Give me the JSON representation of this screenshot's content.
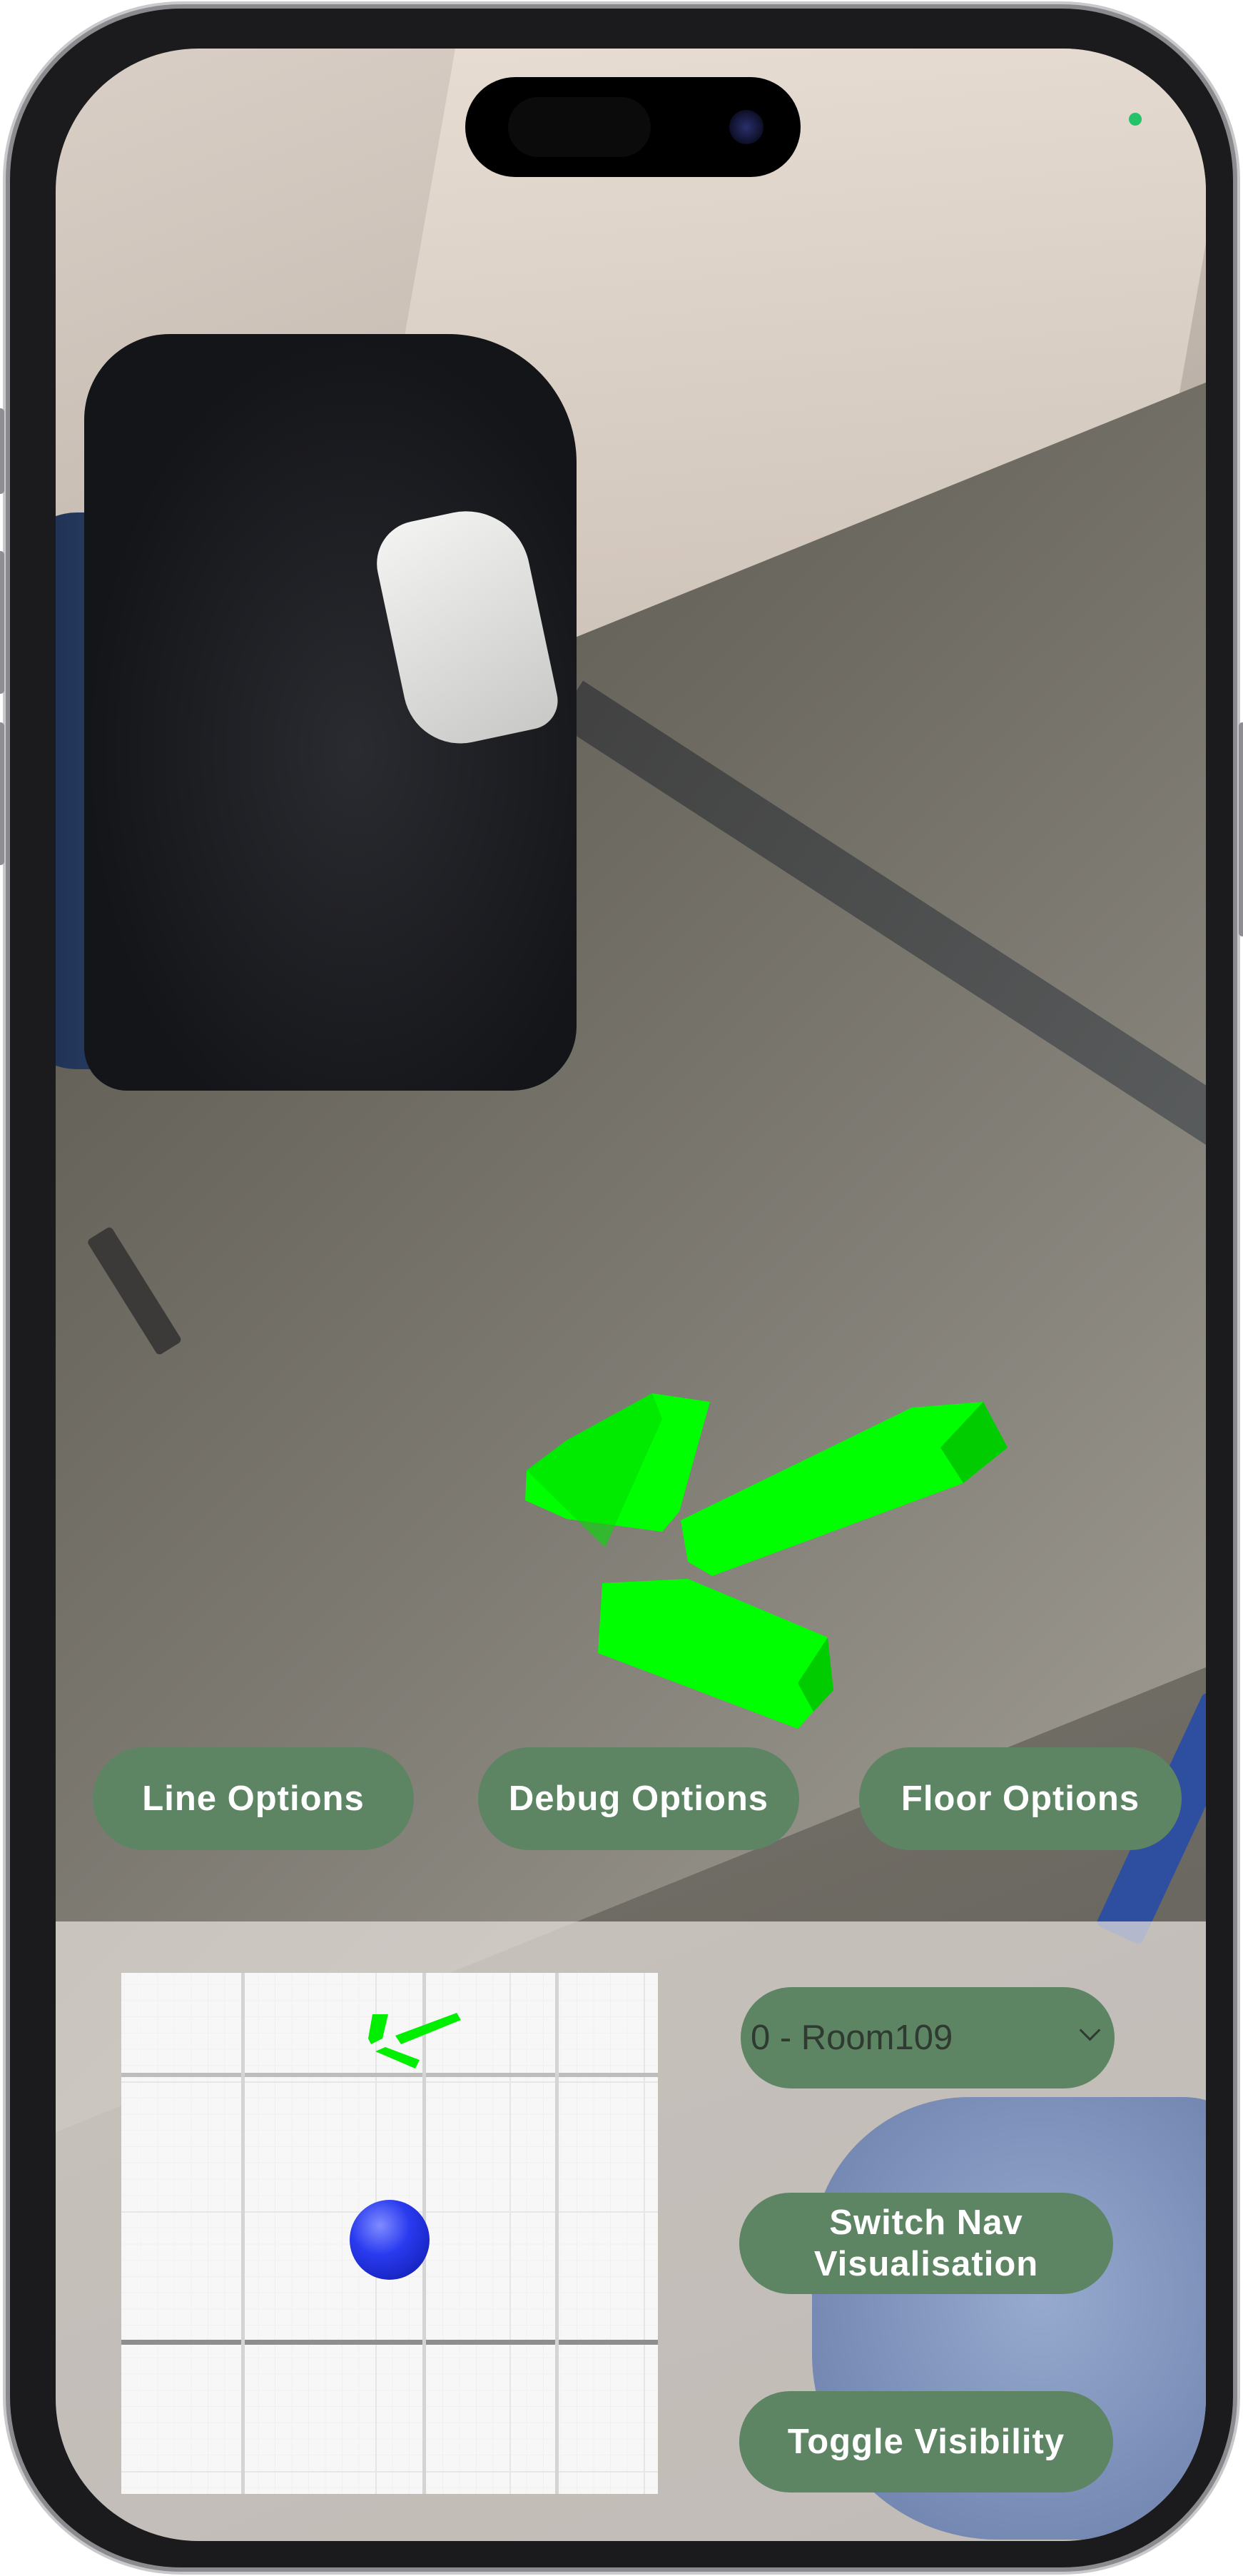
{
  "buttons": {
    "line_options": "Line Options",
    "debug_options": "Debug Options",
    "floor_options": "Floor Options",
    "switch_nav": "Switch Nav Visualisation",
    "toggle_visibility": "Toggle Visibility"
  },
  "room_select": {
    "selected": "0 - Room109"
  },
  "colors": {
    "button_bg": "#5d8563",
    "button_text": "#ffffff",
    "ar_arrow": "#00ff00",
    "player_ball": "#2a3bef",
    "recording_dot": "#25c26a"
  },
  "icons": {
    "ar_arrow": "nav-arrow-icon",
    "minimap_arrow": "nav-arrow-icon",
    "player": "player-marker-icon",
    "select_chevron": "chevron-down-icon"
  }
}
